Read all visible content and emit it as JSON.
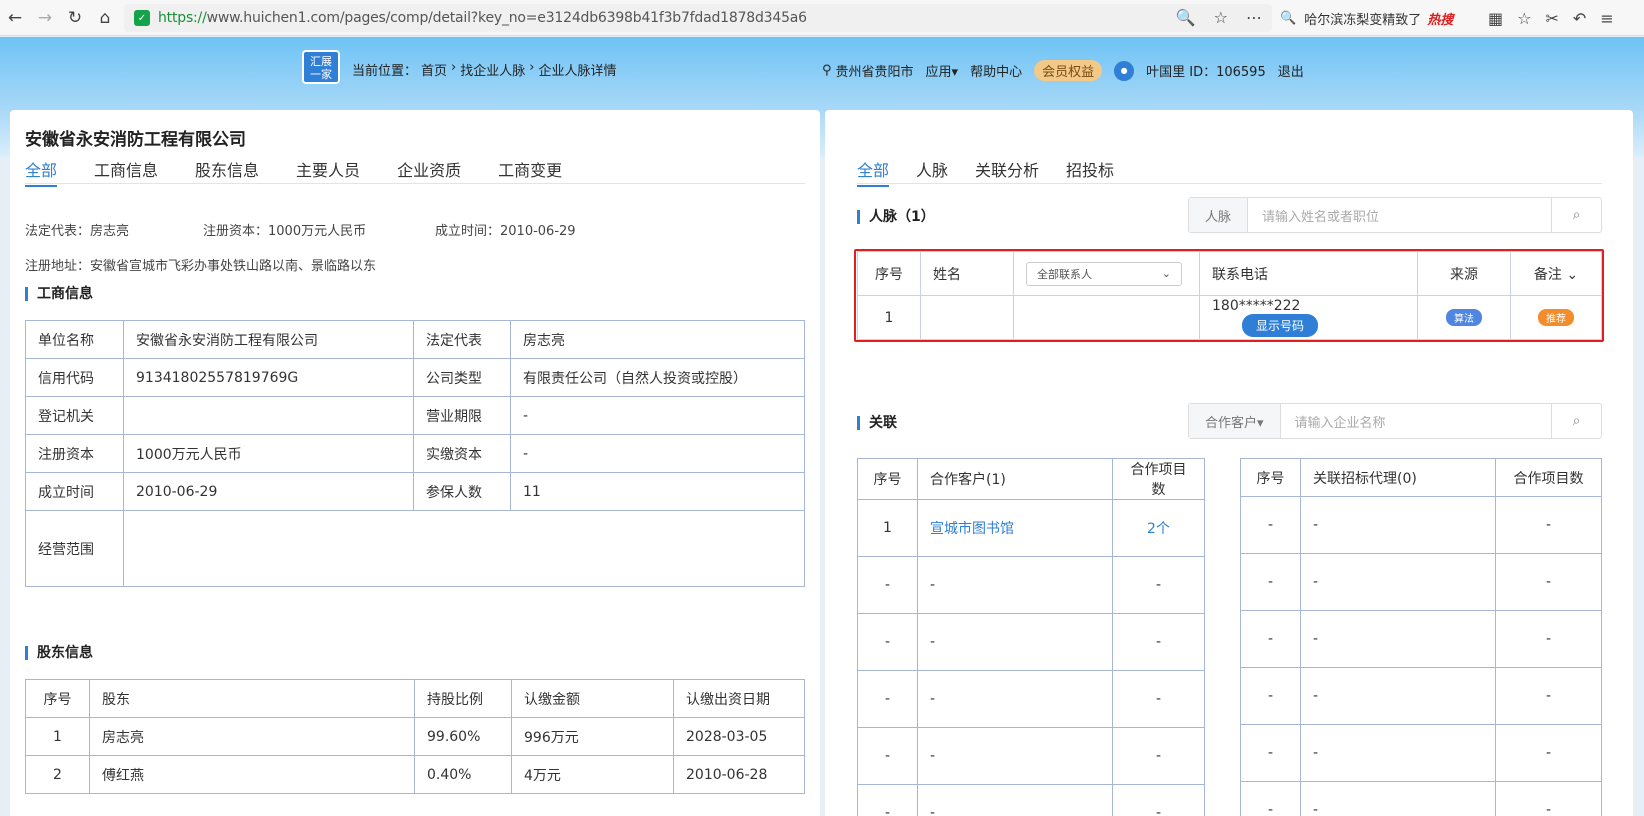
{
  "browser": {
    "url_scheme": "https://",
    "url_rest": "www.huichen1.com/pages/comp/detail?key_no=e3124db6398b41f3b7fdad1878d345a6",
    "hot_search": "哈尔滨冻梨变精致了",
    "hot_label": "热搜"
  },
  "header": {
    "logo_line1": "汇展",
    "logo_line2": "一家",
    "crumb_label": "当前位置：",
    "crumbs": [
      "首页",
      "找企业人脉",
      "企业人脉详情"
    ],
    "location": "贵州省贵阳市",
    "apps": "应用▾",
    "help": "帮助中心",
    "member": "会员权益",
    "user": "叶国里 ID：106595",
    "logout": "退出"
  },
  "company": {
    "name": "安徽省永安消防工程有限公司",
    "tabs": [
      "全部",
      "工商信息",
      "股东信息",
      "主要人员",
      "企业资质",
      "工商变更"
    ],
    "legal_rep": "法定代表：房志亮",
    "capital": "注册资本：1000万元人民币",
    "founded": "成立时间：2010-06-29",
    "address": "注册地址：安徽省宣城市飞彩办事处铁山路以南、景临路以东"
  },
  "biz": {
    "title": "工商信息",
    "rows": [
      [
        "单位名称",
        "安徽省永安消防工程有限公司",
        "法定代表",
        "房志亮"
      ],
      [
        "信用代码",
        "91341802557819769G",
        "公司类型",
        "有限责任公司（自然人投资或控股）"
      ],
      [
        "登记机关",
        "",
        "营业期限",
        "-"
      ],
      [
        "注册资本",
        "1000万元人民币",
        "实缴资本",
        "-"
      ],
      [
        "成立时间",
        "2010-06-29",
        "参保人数",
        "11"
      ]
    ],
    "scope_label": "经营范围"
  },
  "shareholders": {
    "title": "股东信息",
    "headers": [
      "序号",
      "股东",
      "持股比例",
      "认缴金额",
      "认缴出资日期"
    ],
    "rows": [
      [
        "1",
        "房志亮",
        "99.60%",
        "996万元",
        "2028-03-05"
      ],
      [
        "2",
        "傅红燕",
        "0.40%",
        "4万元",
        "2010-06-28"
      ]
    ]
  },
  "right": {
    "tabs": [
      "全部",
      "人脉",
      "关联分析",
      "招投标"
    ],
    "people_title": "人脉（1）",
    "people_search_label": "人脉",
    "people_search_ph": "请输入姓名或者职位",
    "people_headers": [
      "序号",
      "姓名",
      "全部联系人",
      "联系电话",
      "来源",
      "备注"
    ],
    "people_row": {
      "no": "1",
      "phone": "180*****222",
      "show": "显示号码",
      "source": "算法",
      "note": "推荐"
    },
    "rel_title": "关联",
    "rel_search_label": "合作客户▾",
    "rel_search_ph": "请输入企业名称",
    "rel_left_headers": [
      "序号",
      "合作客户(1)",
      "合作项目数"
    ],
    "rel_left_rows": [
      [
        "1",
        "宣城市图书馆",
        "2个"
      ],
      [
        "-",
        "-",
        "-"
      ],
      [
        "-",
        "-",
        "-"
      ],
      [
        "-",
        "-",
        "-"
      ],
      [
        "-",
        "-",
        "-"
      ],
      [
        "-",
        "-",
        "-"
      ]
    ],
    "rel_right_headers": [
      "序号",
      "关联招标代理(0)",
      "合作项目数"
    ],
    "rel_right_rows": [
      [
        "-",
        "-",
        "-"
      ],
      [
        "-",
        "-",
        "-"
      ],
      [
        "-",
        "-",
        "-"
      ],
      [
        "-",
        "-",
        "-"
      ],
      [
        "-",
        "-",
        "-"
      ],
      [
        "-",
        "-",
        "-"
      ]
    ]
  }
}
